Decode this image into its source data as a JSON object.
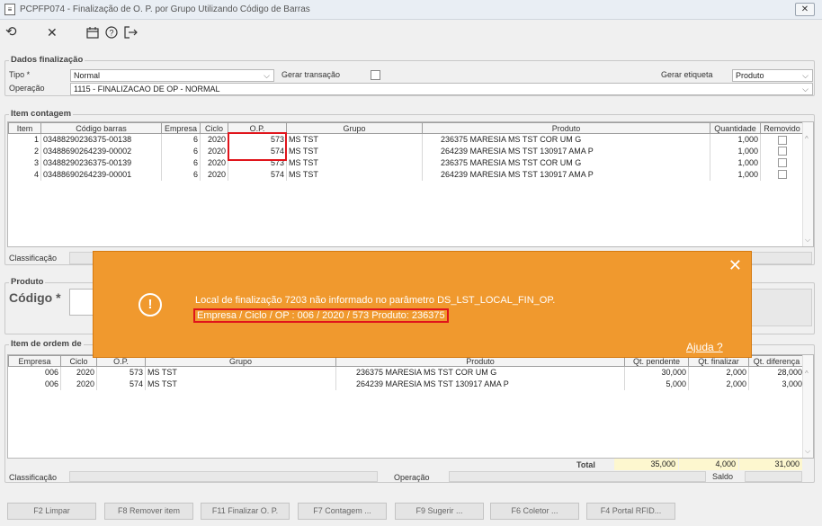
{
  "window": {
    "title": "PCPFP074 - Finalização de O. P.  por Grupo Utilizando Código de Barras",
    "close_glyph": "✕"
  },
  "toolbar": {
    "icons": [
      "undo-icon",
      "cancel-icon",
      "calendar-icon",
      "help-icon",
      "exit-icon"
    ]
  },
  "dados": {
    "legend": "Dados finalização",
    "tipo_label": "Tipo *",
    "tipo_value": "Normal",
    "gerar_transacao_label": "Gerar transação",
    "gerar_etiqueta_label": "Gerar etiqueta",
    "gerar_etiqueta_value": "Produto",
    "operacao_label": "Operação",
    "operacao_value": "1115 - FINALIZACAO DE OP - NORMAL"
  },
  "item_contagem": {
    "legend": "Item contagem",
    "headers": [
      "Item",
      "Código barras",
      "Empresa",
      "Ciclo",
      "O.P.",
      "Grupo",
      "Produto",
      "Quantidade",
      "Removido"
    ],
    "rows": [
      [
        "1",
        "03488290236375-00138",
        "6",
        "2020",
        "573",
        "MS TST",
        "236375 MARESIA MS TST COR UM G",
        "1,000"
      ],
      [
        "2",
        "03488690264239-00002",
        "6",
        "2020",
        "574",
        "MS TST",
        "264239 MARESIA MS TST 130917 AMA P",
        "1,000"
      ],
      [
        "3",
        "03488290236375-00139",
        "6",
        "2020",
        "573",
        "MS TST",
        "236375 MARESIA MS TST COR UM G",
        "1,000"
      ],
      [
        "4",
        "03488690264239-00001",
        "6",
        "2020",
        "574",
        "MS TST",
        "264239 MARESIA MS TST 130917 AMA P",
        "1,000"
      ]
    ],
    "classificacao_label": "Classificação"
  },
  "produto": {
    "legend": "Produto",
    "codigo_label": "Código *"
  },
  "item_ordem": {
    "legend": "Item de ordem de",
    "headers": [
      "Empresa",
      "Ciclo",
      "O.P.",
      "Grupo",
      "Produto",
      "Qt. pendente",
      "Qt. finalizar",
      "Qt. diferença"
    ],
    "rows": [
      [
        "006",
        "2020",
        "573",
        "MS TST",
        "236375 MARESIA MS TST COR UM G",
        "30,000",
        "2,000",
        "28,000"
      ],
      [
        "006",
        "2020",
        "574",
        "MS TST",
        "264239 MARESIA MS TST 130917 AMA P",
        "5,000",
        "2,000",
        "3,000"
      ]
    ],
    "total_label": "Total",
    "total_pendente": "35,000",
    "total_finalizar": "4,000",
    "total_diferenca": "31,000",
    "saldo_label": "Saldo",
    "classificacao_label": "Classificação",
    "operacao_label": "Operação"
  },
  "toast": {
    "message": "Local de finalização 7203 não informado no parâmetro DS_LST_LOCAL_FIN_OP.",
    "detail": "Empresa / Ciclo / OP : 006 / 2020 / 573 Produto: 236375",
    "help": "Ajuda ?",
    "close_glyph": "✕",
    "icon_glyph": "!"
  },
  "footer_buttons": [
    "F2 Limpar",
    "F8 Remover item",
    "F11 Finalizar O. P.",
    "F7 Contagem ...",
    "F9 Sugerir ...",
    "F6 Coletor ...",
    "F4 Portal RFID..."
  ],
  "colors": {
    "toast_bg": "#f0992e",
    "highlight_border": "#e0141b",
    "total_highlight": "#fdf7cf"
  }
}
